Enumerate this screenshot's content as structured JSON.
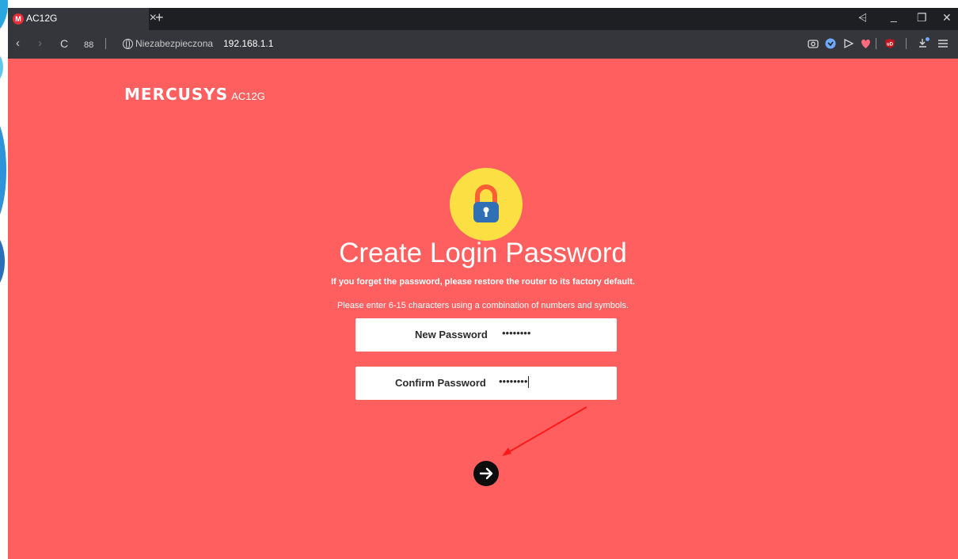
{
  "browser": {
    "tab": {
      "favicon_letter": "M",
      "title": "AC12G",
      "close": "×"
    },
    "new_tab": "+",
    "window_controls": {
      "menu": "⩤",
      "minimize": "_",
      "restore": "❐",
      "close": "✕"
    },
    "nav": {
      "back": "‹",
      "forward": "›",
      "reload": "C",
      "tabs_overview": "88"
    },
    "address": {
      "security_label": "Niezabezpieczona",
      "url": "192.168.1.1"
    },
    "extension_icons": [
      "camera-icon",
      "shield-icon",
      "send-icon",
      "heart-icon",
      "ublock-icon",
      "download-icon",
      "menu-icon"
    ]
  },
  "page": {
    "brand": {
      "logo": "MERCUSYS",
      "model": "AC12G"
    },
    "heading": "Create Login Password",
    "warning": "If you forget the password, please restore the router to its factory default.",
    "hint": "Please enter 6-15 characters using a combination of numbers and symbols.",
    "new_password": {
      "label": "New Password",
      "value": "••••••••"
    },
    "confirm_password": {
      "label": "Confirm Password",
      "value": "••••••••"
    }
  },
  "colors": {
    "page_bg": "#ff5f5f",
    "lock_circle": "#fce043",
    "lock_body": "#2f6fb3",
    "lock_shackle": "#ff5f35",
    "annotation_arrow": "#ff1a1a"
  }
}
